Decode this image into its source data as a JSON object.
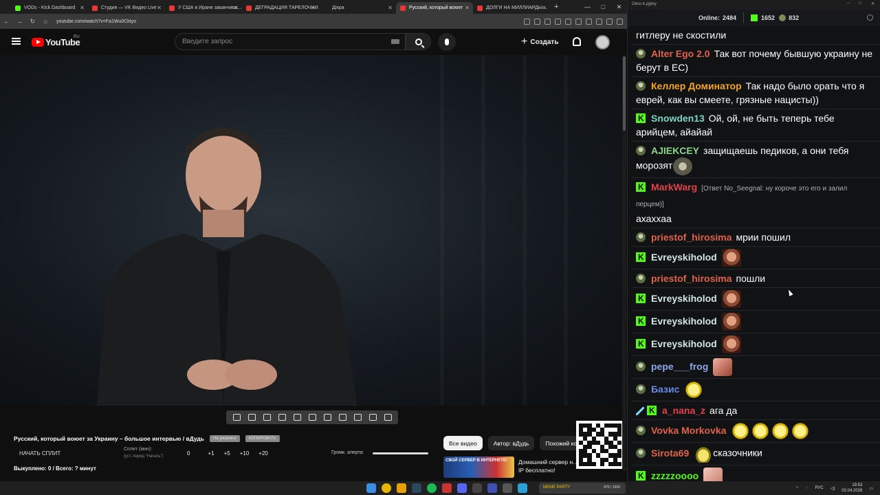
{
  "browser": {
    "tabs": [
      {
        "label": "VODs - Kick Dashboard",
        "fav": "k",
        "active": false
      },
      {
        "label": "Студия — VK Видео Live",
        "fav": "r",
        "active": false
      },
      {
        "label": "У США в Иране заканчива…",
        "fav": "r",
        "active": false
      },
      {
        "label": "ДЕГРАДАЦИЯ ТАРЕЛОЧНИ…",
        "fav": "r",
        "active": false
      },
      {
        "label": "Діхра",
        "fav": "",
        "active": false
      },
      {
        "label": "Русский, который воюет",
        "fav": "r",
        "active": true
      },
      {
        "label": "ДОЛГИ НА МИЛЛИАРДЫ…",
        "fav": "r",
        "active": false
      }
    ],
    "url": "youtube.com/watch?v=Fa1Wu0Cktyo"
  },
  "youtube": {
    "logo_text": "YouTube",
    "logo_region": "RU",
    "search_placeholder": "Введите запрос",
    "create_label": "Создать",
    "video_title": "Русский, который воюет за Украину – большое интервью / вДудь",
    "chip_save": "На ужаемся",
    "chip_copy": "КОПИРОВАТЬ",
    "start_split": "НАЧАТЬ СПЛИТ",
    "split_label": "Сплит (мин):",
    "split_hint": "(уст. перед \"Начать\")",
    "split_values": [
      "0",
      "+1",
      "+5",
      "+10",
      "+20"
    ],
    "volume_label": "Громк. алерта:",
    "volume_level": 1.0,
    "bought": "Выкуплено: 0 / Всего: ? минут",
    "filters": [
      {
        "label": "Все видео",
        "active": true
      },
      {
        "label": "Автор: вДудь",
        "active": false
      },
      {
        "label": "Похожий ко…",
        "active": false
      }
    ],
    "rec_thumb_text": "СВОЙ СЕРВЕР В ИНТЕРНЕТЕ!",
    "rec_title": "Домашний сервер н… динамическом IP бесплатно!"
  },
  "chat": {
    "window_title": "Окно в дурку",
    "online_label": "Online:",
    "online_count": "2484",
    "kick_count": "1652",
    "twitch_count": "832",
    "messages": [
      {
        "platform": "",
        "nick": "",
        "color": "#ffffff",
        "text": "гитлеру не скостили",
        "emotes": []
      },
      {
        "platform": "tw",
        "nick": "Alter Ego 2.0",
        "color": "#e0634c",
        "text": "Так вот почему бывшую украину не берут в ЕС)",
        "emotes": []
      },
      {
        "platform": "tw",
        "nick": "Келлер Доминатор",
        "color": "#f6a623",
        "text": "Так надо было орать что я еврей, как вы смеете, грязные нацисты))",
        "emotes": []
      },
      {
        "platform": "kick",
        "nick": "Snowden13",
        "color": "#7ed4c4",
        "text": "Ой, ой, не быть теперь тебе арийцем, айайай",
        "emotes": []
      },
      {
        "platform": "tw",
        "nick": "AJIEKCEY",
        "color": "#8bd68b",
        "text": "защищаешь педиков, а они тебя морозят",
        "emotes": [
          "dog"
        ]
      },
      {
        "platform": "kick",
        "nick": "MarkWarg",
        "color": "#e0434c",
        "reply": "[Ответ No_Seegnal: ну короче это его и залил перцем)]",
        "text": "ахаххаа",
        "emotes": []
      },
      {
        "platform": "tw",
        "nick": "priestof_hirosima",
        "color": "#e0634c",
        "text": "мрии пошил",
        "emotes": []
      },
      {
        "platform": "kick",
        "nick": "Evreyskiholod",
        "color": "#d0e8e0",
        "text": "",
        "emotes": [
          "face"
        ]
      },
      {
        "platform": "tw",
        "nick": "priestof_hirosima",
        "color": "#e0634c",
        "text": "пошли",
        "emotes": []
      },
      {
        "platform": "kick",
        "nick": "Evreyskiholod",
        "color": "#d0e8e0",
        "text": "",
        "emotes": [
          "face"
        ]
      },
      {
        "platform": "kick",
        "nick": "Evreyskiholod",
        "color": "#d0e8e0",
        "text": "",
        "emotes": [
          "face"
        ]
      },
      {
        "platform": "kick",
        "nick": "Evreyskiholod",
        "color": "#d0e8e0",
        "text": "",
        "emotes": [
          "face"
        ]
      },
      {
        "platform": "tw",
        "nick": "pepe___frog",
        "color": "#8aa8e8",
        "text": "",
        "emotes": [
          "frog"
        ]
      },
      {
        "platform": "tw",
        "nick": "Базис",
        "color": "#6a8ae8",
        "text": "",
        "emotes": [
          "smile"
        ]
      },
      {
        "platform": "kick2",
        "nick": "a_nana_z",
        "color": "#e0434c",
        "text": "ага да",
        "emotes": []
      },
      {
        "platform": "tw",
        "nick": "Vovka Morkovka",
        "color": "#e0634c",
        "text": "",
        "emotes": [
          "smile",
          "smile",
          "smile",
          "smile"
        ]
      },
      {
        "platform": "tw",
        "nick": "Sirota69",
        "color": "#e0634c",
        "text": "сказочники",
        "emotes": [
          "banana"
        ]
      },
      {
        "platform": "kick",
        "nick": "zzzzzoooo",
        "color": "#53fc18",
        "text": "",
        "emotes": [
          "pink"
        ]
      }
    ]
  },
  "taskbar": {
    "meme_label": "MEME PARTY",
    "meme_sub": "875 / 1500",
    "lang": "РУС",
    "time": "19:53",
    "date": "02.04.2026"
  }
}
